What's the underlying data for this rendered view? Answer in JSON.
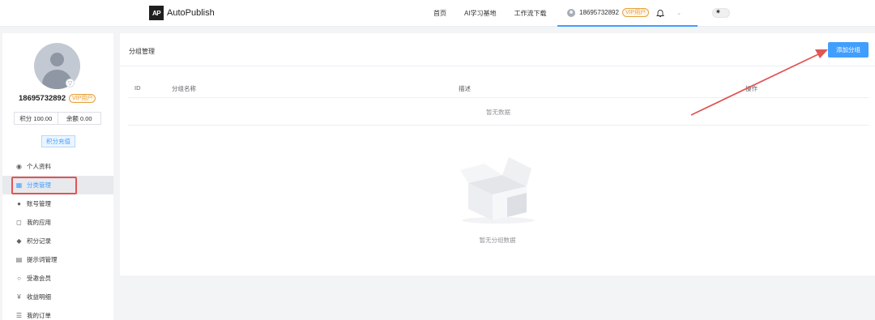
{
  "header": {
    "logo_mark": "AP",
    "brand": "AutoPublish",
    "nav": [
      "首页",
      "AI学习基地",
      "工作流下载"
    ],
    "user_phone": "18695732892",
    "vip_label": "VIP用户"
  },
  "profile": {
    "phone": "18695732892",
    "vip_label": "VIP用户",
    "points_label": "积分 100.00",
    "balance_label": "余额 0.00",
    "recharge_label": "积分充值"
  },
  "menu": [
    {
      "label": "个人资料",
      "icon": "user-circle-icon",
      "glyph": "◉"
    },
    {
      "label": "分类管理",
      "icon": "grid-icon",
      "glyph": "▦",
      "active": true
    },
    {
      "label": "账号管理",
      "icon": "person-icon",
      "glyph": "●"
    },
    {
      "label": "我的应用",
      "icon": "bag-icon",
      "glyph": "◻"
    },
    {
      "label": "积分记录",
      "icon": "tag-icon",
      "glyph": "◆"
    },
    {
      "label": "提示词管理",
      "icon": "document-icon",
      "glyph": "▤"
    },
    {
      "label": "受邀会员",
      "icon": "member-icon",
      "glyph": "○"
    },
    {
      "label": "收益明细",
      "icon": "yen-icon",
      "glyph": "¥"
    },
    {
      "label": "我的订单",
      "icon": "order-icon",
      "glyph": "☰"
    }
  ],
  "main": {
    "title": "分组管理",
    "add_button": "添加分组",
    "columns": [
      "ID",
      "分组名称",
      "描述",
      "操作"
    ],
    "empty_row_text": "暂无数据",
    "empty_text": "暂无分组数据"
  },
  "colors": {
    "accent": "#409eff",
    "annotation": "#e05555",
    "vip": "#e6a23c"
  }
}
